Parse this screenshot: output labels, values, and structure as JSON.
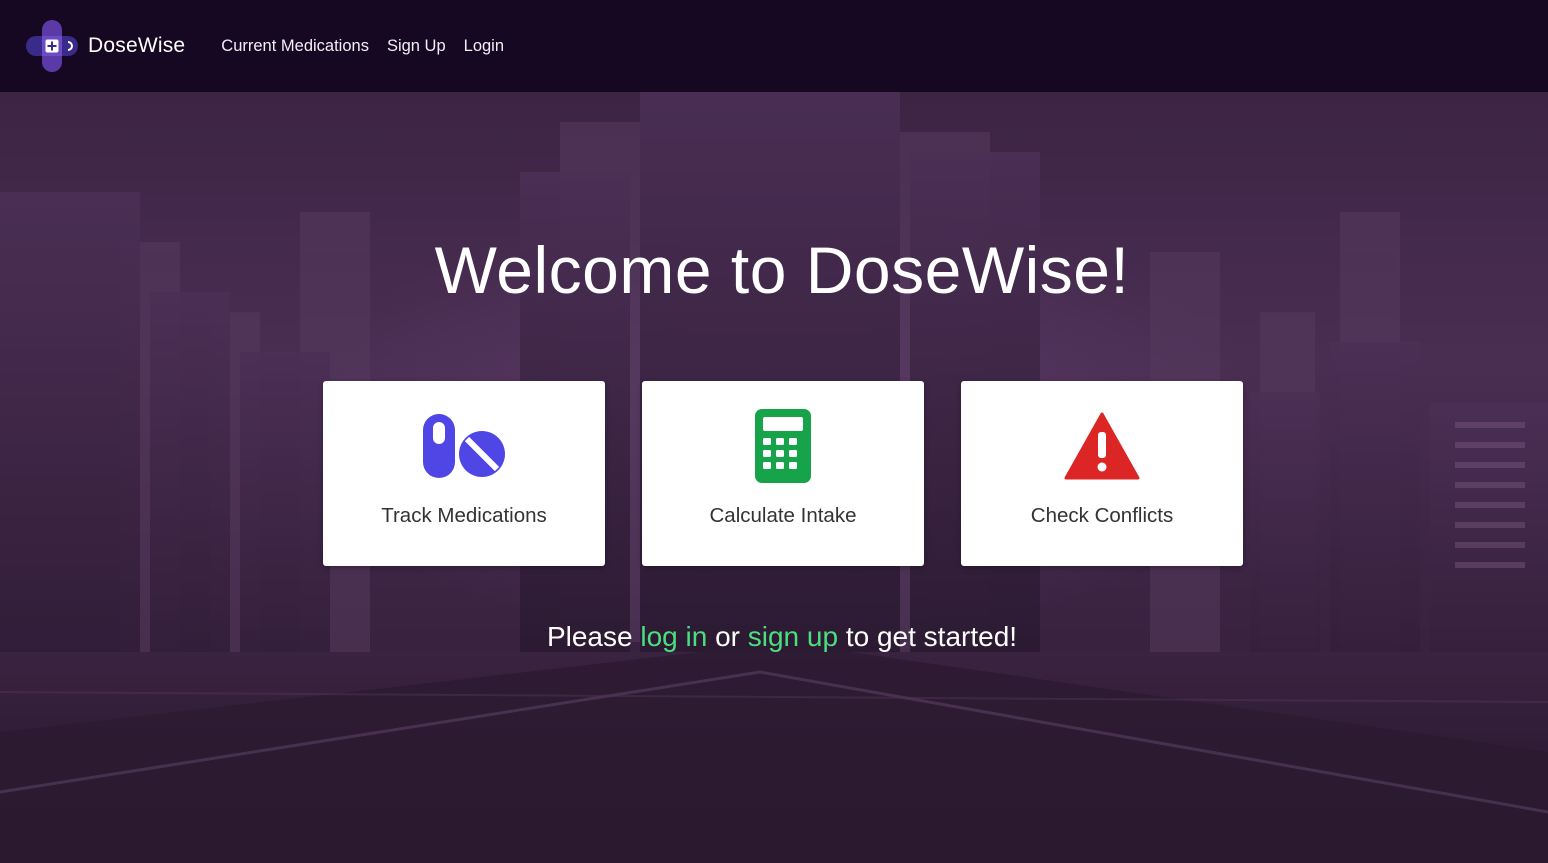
{
  "navbar": {
    "brand_name": "DoseWise",
    "links": [
      {
        "label": "Current Medications"
      },
      {
        "label": "Sign Up"
      },
      {
        "label": "Login"
      }
    ]
  },
  "hero": {
    "title": "Welcome to DoseWise!"
  },
  "features": [
    {
      "label": "Track Medications",
      "icon": "pills-icon",
      "color": "#4f46e5"
    },
    {
      "label": "Calculate Intake",
      "icon": "calculator-icon",
      "color": "#16a34a"
    },
    {
      "label": "Check Conflicts",
      "icon": "warning-icon",
      "color": "#dc2626"
    }
  ],
  "cta": {
    "prefix": "Please",
    "login_link": "log in",
    "middle": "or",
    "signup_link": "sign up",
    "suffix": "to get started!"
  },
  "colors": {
    "navbar_bg": "#160822",
    "link_accent": "#4ade80",
    "card_bg": "#ffffff"
  }
}
